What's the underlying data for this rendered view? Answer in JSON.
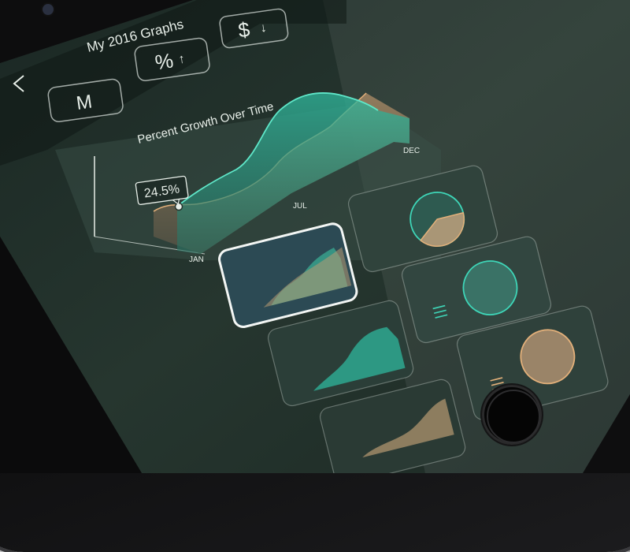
{
  "header": {
    "title": "My 2016 Graphs",
    "back_icon": "chevron-left-icon"
  },
  "controls": {
    "currency_label": "$",
    "currency_arrow": "↓",
    "percent_label": "%",
    "percent_arrow": "↑",
    "period_label": "M"
  },
  "main_chart": {
    "title": "Percent Growth Over Time",
    "tooltip": "24.5%",
    "x_labels": [
      "JAN",
      "JUL",
      "DEC"
    ]
  },
  "colors": {
    "teal": "#3ed6b8",
    "orange": "#e3b07a",
    "background": "#1f2e29"
  },
  "thumbnails": [
    {
      "type": "area",
      "selected": true
    },
    {
      "type": "area",
      "selected": false
    },
    {
      "type": "area",
      "selected": false
    },
    {
      "type": "pie",
      "selected": false
    },
    {
      "type": "circle",
      "selected": false
    },
    {
      "type": "circle",
      "selected": false
    }
  ]
}
